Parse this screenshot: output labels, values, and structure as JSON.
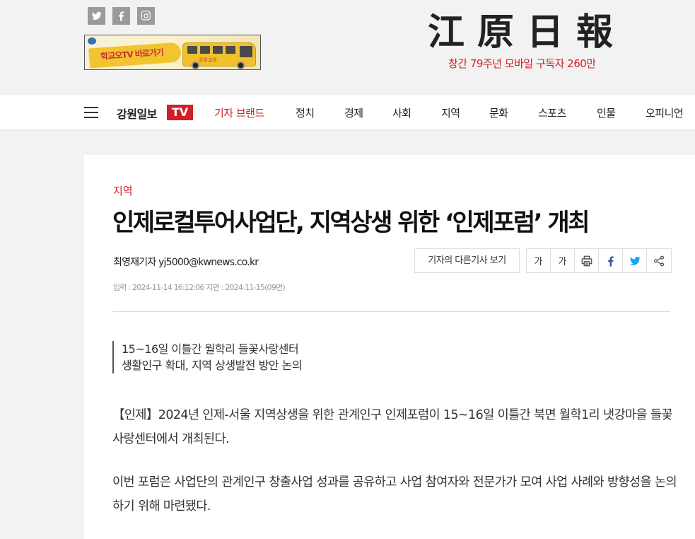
{
  "header": {
    "masthead_title": "江原日報",
    "masthead_sub": "창간 79주년 모바일 구독자 260만",
    "social": [
      "twitter-icon",
      "facebook-icon",
      "instagram-icon"
    ],
    "banner": {
      "main_text": "학교오TV 바로가기",
      "brand": "강원교육"
    }
  },
  "nav": {
    "brand": "강원일보",
    "tv": "TV",
    "items": [
      "기자 브랜드",
      "정치",
      "경제",
      "사회",
      "지역",
      "문화",
      "스포츠",
      "인물",
      "오피니언"
    ]
  },
  "article": {
    "section": "지역",
    "headline": "인제로컬투어사업단, 지역상생 위한 ‘인제포럼’ 개최",
    "byline": "최영재기자 yj5000@kwnews.co.kr",
    "dates": "입력 : 2024-11-14 16:12:06 지면 : 2024-11-15(09면)",
    "other_articles_button": "기자의 다른기사 보기",
    "tools": {
      "font_small": "가",
      "font_large": "가"
    },
    "summary": [
      "15~16일 이틀간 월학리 들꽃사랑센터",
      "생활인구 확대, 지역 상생발전 방안 논의"
    ],
    "paragraphs": [
      "【인제】2024년 인제-서울 지역상생을 위한 관계인구 인제포럼이 15~16일 이틀간 북면 월학1리 냇강마을 들꽃사랑센터에서 개최된다.",
      "이번 포럼은 사업단의 관계인구 창출사업 성과를 공유하고 사업 참여자와 전문가가 모여 사업 사례와 방향성을 논의하기 위해 마련됐다."
    ]
  },
  "colors": {
    "accent": "#d01f27",
    "twitter": "#1da1f2",
    "facebook": "#3b5998"
  }
}
